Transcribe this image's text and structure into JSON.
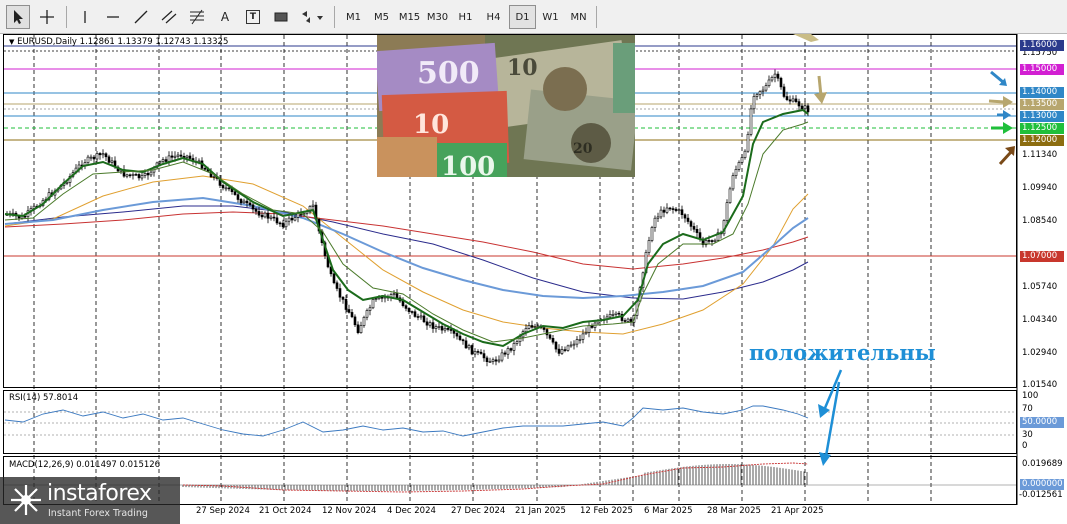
{
  "toolbar": {
    "tools": [
      {
        "name": "cursor-tool",
        "icon": "arrow-cursor-icon"
      },
      {
        "name": "crosshair-tool",
        "icon": "crosshair-icon"
      },
      {
        "name": "vertical-line-tool",
        "icon": "vertical-line-icon"
      },
      {
        "name": "horizontal-line-tool",
        "icon": "horizontal-line-icon"
      },
      {
        "name": "trendline-tool",
        "icon": "trendline-icon"
      },
      {
        "name": "equidistant-channel-tool",
        "icon": "channel-icon"
      },
      {
        "name": "fibonacci-tool",
        "icon": "fibonacci-icon"
      },
      {
        "name": "text-tool",
        "label": "A"
      },
      {
        "name": "text-label-tool",
        "label": "T"
      },
      {
        "name": "shapes-tool",
        "icon": "rectangle-icon"
      },
      {
        "name": "arrows-tool",
        "icon": "arrows-icon"
      }
    ],
    "timeframes": [
      "M1",
      "M5",
      "M15",
      "M30",
      "H1",
      "H4",
      "D1",
      "W1",
      "MN"
    ],
    "active_timeframe": "D1"
  },
  "main_panel": {
    "title": "EURUSD,Daily  1.12861 1.13379 1.12743 1.13325",
    "axis_ticks": [
      "1.15750",
      "1.11340",
      "1.09940",
      "1.08540",
      "1.05740",
      "1.04340",
      "1.02940",
      "1.01540"
    ],
    "price_labels": [
      {
        "text": "1.16000",
        "color": "#2b3a8c"
      },
      {
        "text": "1.15000",
        "color": "#d21fd2"
      },
      {
        "text": "1.14000",
        "color": "#2f87c7"
      },
      {
        "text": "1.13500",
        "color": "#b7a66e"
      },
      {
        "text": "1.13000",
        "color": "#2f87c7"
      },
      {
        "text": "1.12500",
        "color": "#1fbf3a"
      },
      {
        "text": "1.12000",
        "color": "#8c6d10"
      },
      {
        "text": "1.07000",
        "color": "#c8372d"
      }
    ]
  },
  "rsi_panel": {
    "title": "RSI(14) 57.8014",
    "ticks": [
      "100",
      "70",
      "30",
      "0"
    ],
    "level_label": "50.0000"
  },
  "macd_panel": {
    "title": "MACD(12,26,9) 0.011497 0.015126",
    "ticks": [
      "0.019689",
      "-0.012561"
    ],
    "level_label": "0.000000"
  },
  "date_ticks": [
    "27 Sep 2024",
    "21 Oct 2024",
    "12 Nov 2024",
    "4 Dec 2024",
    "27 Dec 2024",
    "21 Jan 2025",
    "12 Feb 2025",
    "6 Mar 2025",
    "28 Mar 2025",
    "21 Apr 2025"
  ],
  "annotation": "положительны",
  "logo": {
    "name": "instaforex",
    "tagline": "Instant Forex Trading"
  },
  "colors": {
    "toolbar_bg": "#f0f0f0",
    "bull_candle": "#ffffff",
    "bear_candle": "#000000",
    "fast_ma": "#1b6b1b",
    "ma_blue": "#6b9ad8",
    "ma_orange": "#e0a030",
    "ma_red": "#c83232",
    "ma_navy": "#2b2b8c",
    "annotation": "#1e8fd6"
  }
}
